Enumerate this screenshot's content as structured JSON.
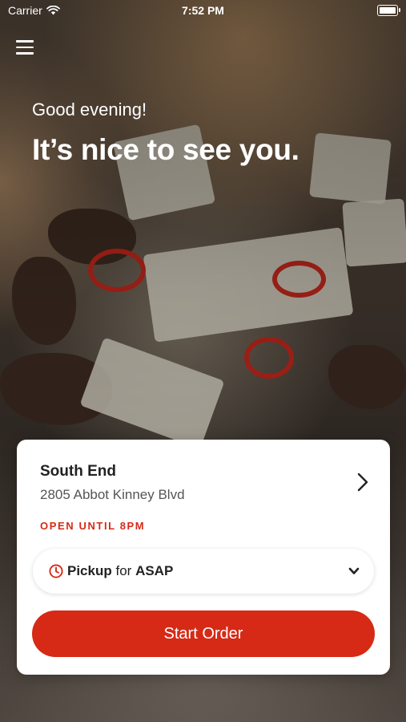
{
  "status_bar": {
    "carrier": "Carrier",
    "time": "7:52 PM"
  },
  "hero": {
    "greeting": "Good evening!",
    "headline": "It’s nice to see you."
  },
  "location": {
    "name": "South End",
    "address": "2805 Abbot Kinney Blvd",
    "hours": "OPEN UNTIL 8PM"
  },
  "pickup": {
    "mode": "Pickup",
    "connector": "for",
    "time": "ASAP"
  },
  "actions": {
    "start_order": "Start Order"
  },
  "colors": {
    "accent": "#d62a16"
  },
  "icons": {
    "menu": "hamburger-menu-icon",
    "wifi": "wifi-icon",
    "battery": "battery-icon",
    "chevron": "chevron-right-icon",
    "clock": "clock-icon",
    "caret": "chevron-down-icon"
  }
}
